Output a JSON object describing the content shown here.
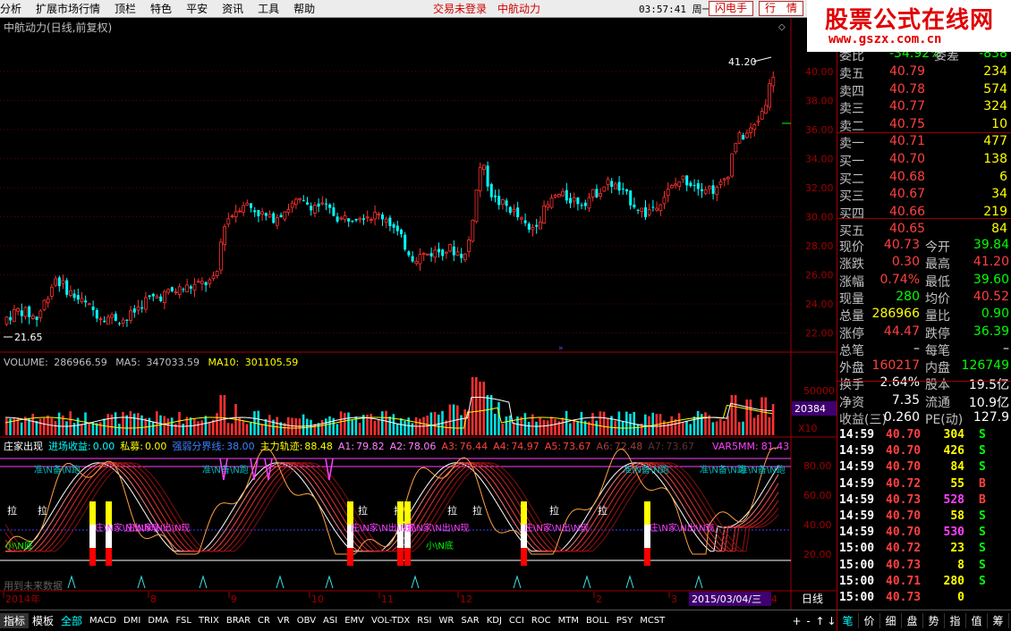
{
  "menubar": {
    "items": [
      "分析",
      "扩展市场行情",
      "顶栏",
      "特色",
      "平安",
      "资讯",
      "工具",
      "帮助"
    ],
    "login_status": "交易未登录",
    "stock_name": "中航动力",
    "clock": "03:57:41 周一",
    "flash_btn": "闪电手",
    "quote_btn": "行　情"
  },
  "logo": {
    "title": "股票公式在线网",
    "url": "www.gszx.com.cn"
  },
  "main_chart": {
    "title": "中航动力(日线,前复权)",
    "high_label": "41.20",
    "low_label": "21.65",
    "y_ticks": [
      "40.00",
      "38.00",
      "36.00",
      "34.00",
      "32.00",
      "30.00",
      "28.00",
      "26.00",
      "24.00",
      "22.00"
    ]
  },
  "volume_panel": {
    "label": "VOLUME:",
    "volume": "286966.59",
    "ma5_label": "MA5:",
    "ma5": "347033.59",
    "ma10_label": "MA10:",
    "ma10": "301105.59",
    "y_tick": "50000",
    "current_box": "20384",
    "unit": "X10"
  },
  "indicator_panel": {
    "name": "庄家出现",
    "items": [
      {
        "label": "进场收益:",
        "value": "0.00",
        "color": "#00ffff"
      },
      {
        "label": "私募:",
        "value": "0.00",
        "color": "#ffff00"
      },
      {
        "label": "强弱分界线:",
        "value": "38.00",
        "color": "#4080ff"
      },
      {
        "label": "主力轨迹:",
        "value": "88.48",
        "color": "#ffff00"
      },
      {
        "label": "A1:",
        "value": "79.82",
        "color": "#ff80ff"
      },
      {
        "label": "A2:",
        "value": "78.06",
        "color": "#ff80ff"
      },
      {
        "label": "A3:",
        "value": "76.44",
        "color": "#ff4040"
      },
      {
        "label": "A4:",
        "value": "74.97",
        "color": "#ff4040"
      },
      {
        "label": "A5:",
        "value": "73.67",
        "color": "#ff4040"
      },
      {
        "label": "A6:",
        "value": "72.48",
        "color": "#a04040"
      },
      {
        "label": "A7:",
        "value": "73.67",
        "color": "#603030"
      }
    ],
    "var_label": "VAR5MM:",
    "var_value": "81.43",
    "y_ticks": [
      "80.00",
      "60.00",
      "40.00",
      "20.00"
    ],
    "tag_pull": "拉",
    "tag_bottom": "小\\N底",
    "tag_zhuang": "庄\\N家\\N出\\N现",
    "tag_ready": "准\\N备\\N跑",
    "footer_note": "用到未来数据"
  },
  "x_axis": {
    "labels": [
      "2014年",
      "8",
      "9",
      "10",
      "11",
      "12",
      "2",
      "3",
      "4"
    ],
    "cursor_date": "2015/03/04/三",
    "period": "日线"
  },
  "quote": {
    "header": [
      {
        "label": "委比",
        "value": "-34.92%",
        "label2": "委差",
        "value2": "-838"
      }
    ],
    "asks": [
      {
        "label": "卖五",
        "price": "40.79",
        "vol": "234"
      },
      {
        "label": "卖四",
        "price": "40.78",
        "vol": "574"
      },
      {
        "label": "卖三",
        "price": "40.77",
        "vol": "324"
      },
      {
        "label": "卖二",
        "price": "40.75",
        "vol": "10"
      },
      {
        "label": "卖一",
        "price": "40.71",
        "vol": "477"
      }
    ],
    "bids": [
      {
        "label": "买一",
        "price": "40.70",
        "vol": "138"
      },
      {
        "label": "买二",
        "price": "40.68",
        "vol": "6"
      },
      {
        "label": "买三",
        "price": "40.67",
        "vol": "34"
      },
      {
        "label": "买四",
        "price": "40.66",
        "vol": "219"
      },
      {
        "label": "买五",
        "price": "40.65",
        "vol": "84"
      }
    ],
    "stats": [
      {
        "l1": "现价",
        "v1": "40.73",
        "c1": "#ff4040",
        "l2": "今开",
        "v2": "39.84",
        "c2": "#00ff00"
      },
      {
        "l1": "涨跌",
        "v1": "0.30",
        "c1": "#ff4040",
        "l2": "最高",
        "v2": "41.20",
        "c2": "#ff4040"
      },
      {
        "l1": "涨幅",
        "v1": "0.74%",
        "c1": "#ff4040",
        "l2": "最低",
        "v2": "39.60",
        "c2": "#00ff00"
      },
      {
        "l1": "现量",
        "v1": "280",
        "c1": "#00ff00",
        "l2": "均价",
        "v2": "40.52",
        "c2": "#ff4040"
      },
      {
        "l1": "总量",
        "v1": "286966",
        "c1": "#ffff00",
        "l2": "量比",
        "v2": "0.90",
        "c2": "#00ff00"
      },
      {
        "l1": "涨停",
        "v1": "44.47",
        "c1": "#ff4040",
        "l2": "跌停",
        "v2": "36.39",
        "c2": "#00ff00"
      },
      {
        "l1": "总笔",
        "v1": "–",
        "c1": "#ffffff",
        "l2": "每笔",
        "v2": "–",
        "c2": "#ffffff"
      },
      {
        "l1": "外盘",
        "v1": "160217",
        "c1": "#ff4040",
        "l2": "内盘",
        "v2": "126749",
        "c2": "#00ff00"
      },
      {
        "l1": "换手",
        "v1": "2.64%",
        "c1": "#ffffff",
        "l2": "股本",
        "v2": "19.5亿",
        "c2": "#ffffff"
      },
      {
        "l1": "净资",
        "v1": "7.35",
        "c1": "#ffffff",
        "l2": "流通",
        "v2": "10.9亿",
        "c2": "#ffffff"
      },
      {
        "l1": "收益(三)",
        "v1": "0.260",
        "c1": "#ffffff",
        "l2": "PE(动)",
        "v2": "127.9",
        "c2": "#ffffff"
      }
    ]
  },
  "ticks": [
    {
      "time": "14:59",
      "price": "40.70",
      "vol": "304",
      "side": "S",
      "pc": "#ff4040",
      "vc": "#ffff00",
      "sc": "#00ff00"
    },
    {
      "time": "14:59",
      "price": "40.70",
      "vol": "426",
      "side": "S",
      "pc": "#ff4040",
      "vc": "#ffff00",
      "sc": "#00ff00"
    },
    {
      "time": "14:59",
      "price": "40.70",
      "vol": "84",
      "side": "S",
      "pc": "#ff4040",
      "vc": "#ffff00",
      "sc": "#00ff00"
    },
    {
      "time": "14:59",
      "price": "40.72",
      "vol": "55",
      "side": "B",
      "pc": "#ff4040",
      "vc": "#ffff00",
      "sc": "#ff4040"
    },
    {
      "time": "14:59",
      "price": "40.73",
      "vol": "528",
      "side": "B",
      "pc": "#ff4040",
      "vc": "#ff40ff",
      "sc": "#ff4040"
    },
    {
      "time": "14:59",
      "price": "40.70",
      "vol": "58",
      "side": "S",
      "pc": "#ff4040",
      "vc": "#ffff00",
      "sc": "#00ff00"
    },
    {
      "time": "14:59",
      "price": "40.70",
      "vol": "530",
      "side": "S",
      "pc": "#ff4040",
      "vc": "#ff40ff",
      "sc": "#00ff00"
    },
    {
      "time": "15:00",
      "price": "40.72",
      "vol": "23",
      "side": "S",
      "pc": "#ff4040",
      "vc": "#ffff00",
      "sc": "#00ff00"
    },
    {
      "time": "15:00",
      "price": "40.73",
      "vol": "8",
      "side": "S",
      "pc": "#ff4040",
      "vc": "#ffff00",
      "sc": "#00ff00"
    },
    {
      "time": "15:00",
      "price": "40.71",
      "vol": "280",
      "side": "S",
      "pc": "#ff4040",
      "vc": "#ffff00",
      "sc": "#00ff00"
    },
    {
      "time": "15:00",
      "price": "40.73",
      "vol": "0",
      "side": "",
      "pc": "#ff4040",
      "vc": "#ffff00",
      "sc": "#00ff00"
    }
  ],
  "bottom_tabs": {
    "group": [
      "指标",
      "模板",
      "全部"
    ],
    "indicators": [
      "MACD",
      "DMI",
      "DMA",
      "FSL",
      "TRIX",
      "BRAR",
      "CR",
      "VR",
      "OBV",
      "ASI",
      "EMV",
      "VOL-TDX",
      "RSI",
      "WR",
      "SAR",
      "KDJ",
      "CCI",
      "ROC",
      "MTM",
      "BOLL",
      "PSY",
      "MCST"
    ],
    "nav": [
      "+",
      "-",
      "↑",
      "↓"
    ],
    "right_tabs": [
      "笔",
      "价",
      "细",
      "盘",
      "势",
      "指",
      "值",
      "筹"
    ]
  },
  "colors": {
    "up": "#ff3030",
    "down": "#00ffff",
    "axis": "#a00000",
    "grid": "#800000"
  }
}
